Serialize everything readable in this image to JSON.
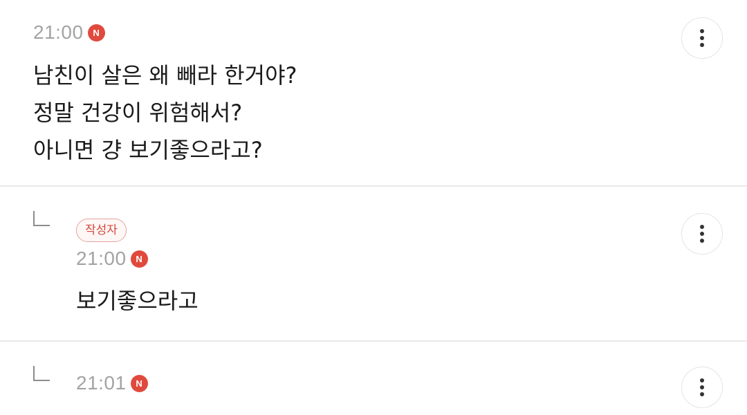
{
  "comments": [
    {
      "time": "21:00",
      "new_badge": "N",
      "lines": [
        "남친이 살은 왜 빼라 한거야?",
        "정말 건강이 위험해서?",
        "아니면 걍 보기좋으라고?"
      ]
    },
    {
      "author_badge": "작성자",
      "time": "21:00",
      "new_badge": "N",
      "lines": [
        "보기좋으라고"
      ]
    },
    {
      "time": "21:01",
      "new_badge": "N"
    }
  ],
  "icons": {
    "more": "more-vertical-icon",
    "reply": "reply-arrow-icon",
    "new": "new-badge-icon"
  },
  "colors": {
    "new_badge": "#e04a3c",
    "author_badge_text": "#d3493d",
    "author_badge_border": "#e6a39d",
    "time": "#a3a3a3"
  }
}
